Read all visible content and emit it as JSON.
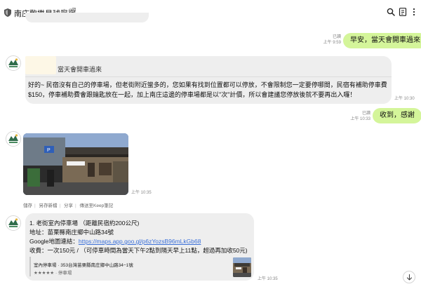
{
  "header": {
    "title": "南庄歡樂星球民宿",
    "icons": [
      "shield-icon",
      "mute-icon",
      "popout-icon",
      "search-icon",
      "notes-icon",
      "more-icon"
    ]
  },
  "messages": {
    "out1": {
      "text": "早安，當天會開車過來",
      "read": "已讀",
      "time": "上午 9:59"
    },
    "reply": {
      "quoted": "當天會開車過來",
      "text": "好的~ 民宿沒有自己的停車場，但老街附近蠻多的，您如果有找到位置都可以停放，不會限制您一定要停哪間，民宿有補助停車費$150，停車補助費會跟鑰匙放在一起，加上南庄這邊的停車場都是以\"次\"計價，所以會建議您停放後就不要再出入囉！",
      "time": "上午 10:30"
    },
    "out2": {
      "text": "收到，感謝",
      "read": "已讀",
      "time": "上午 10:33"
    },
    "photo": {
      "time": "上午 10:35",
      "actions": [
        "儲存",
        "另存新檔",
        "分享",
        "傳送至Keep筆記"
      ]
    },
    "info": {
      "line1": "1. 老街室內停車場 （距離民宿約200公尺)",
      "line2": "地址：苗栗縣南庄鄉中山路34號",
      "line3_label": "Google地圖連結：",
      "line3_link": "https://maps.app.goo.gl/p6zYozsB96mLkGb68",
      "line4": "收費：一次150元 / （可停車時間為當天下午2點到隔天早上11點，超過再加收50元)",
      "preview_title": "室內停車場 · 353台灣苗栗縣南庄鄉中山路34−1號",
      "preview_stars": "★★★★★ · 停車場",
      "time": "上午 10:35"
    }
  },
  "colors": {
    "outgoing": "#d4f59a",
    "incoming": "#eeeeee",
    "link": "#3a6fd8"
  }
}
